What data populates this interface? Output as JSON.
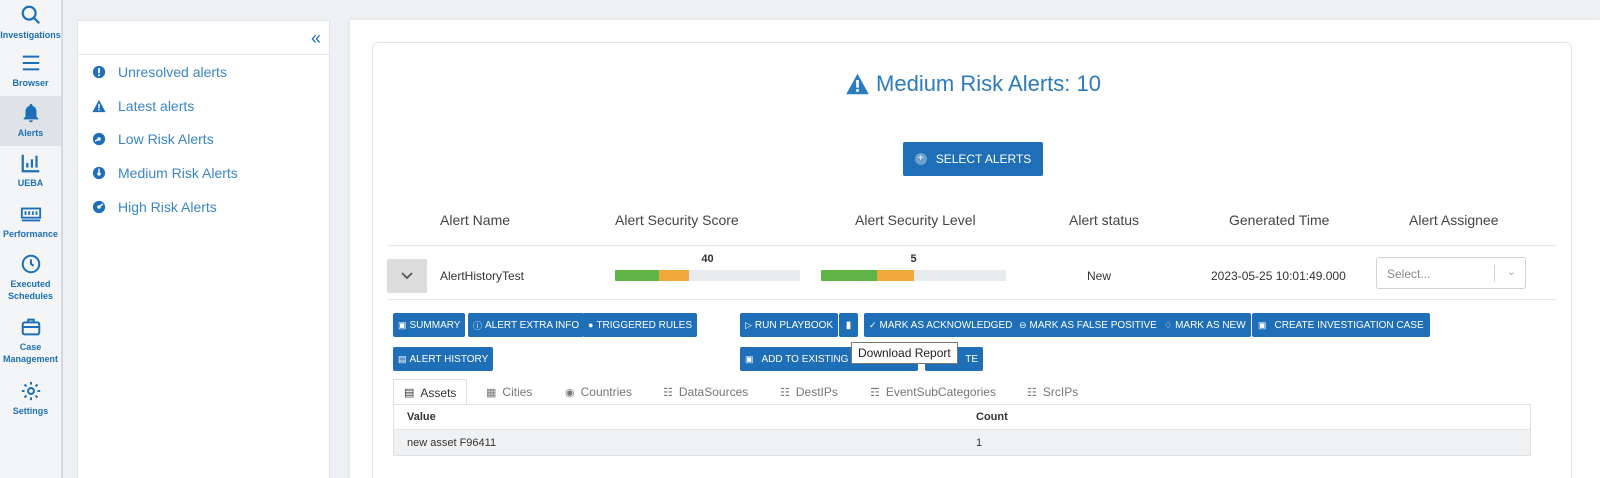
{
  "rail": {
    "items": [
      {
        "label": "Investigations",
        "icon": "search-icon"
      },
      {
        "label": "Browser",
        "icon": "menu-icon"
      },
      {
        "label": "Alerts",
        "icon": "bell-icon"
      },
      {
        "label": "UEBA",
        "icon": "chart-icon"
      },
      {
        "label": "Performance",
        "icon": "memory-icon"
      },
      {
        "label": "Executed Schedules",
        "icon": "clock-icon"
      },
      {
        "label": "Case Management",
        "icon": "briefcase-icon"
      },
      {
        "label": "Settings",
        "icon": "gear-icon"
      }
    ]
  },
  "sidebar": {
    "items": [
      {
        "label": "Unresolved alerts",
        "icon": "exclamation-circle-icon"
      },
      {
        "label": "Latest alerts",
        "icon": "warning-triangle-icon"
      },
      {
        "label": "Low Risk Alerts",
        "icon": "gauge-low-icon"
      },
      {
        "label": "Medium Risk Alerts",
        "icon": "gauge-medium-icon"
      },
      {
        "label": "High Risk Alerts",
        "icon": "gauge-high-icon"
      }
    ]
  },
  "main": {
    "title": "Medium Risk Alerts: 10",
    "select_button": "SELECT ALERTS",
    "columns": [
      "Alert Name",
      "Alert Security Score",
      "Alert Security Level",
      "Alert status",
      "Generated Time",
      "Alert Assignee"
    ],
    "alert": {
      "name": "AlertHistoryTest",
      "score": "40",
      "score_fill": 0.4,
      "level": "5",
      "level_fill": 0.5,
      "status": "New",
      "time": "2023-05-25 10:01:49.000",
      "assignee_placeholder": "Select..."
    },
    "actions": {
      "summary": "SUMMARY",
      "extra_info": "ALERT EXTRA INFO",
      "triggered_rules": "TRIGGERED RULES",
      "alert_history": "ALERT HISTORY",
      "run_playbook": "RUN PLAYBOOK",
      "ack": "MARK AS ACKNOWLEDGED",
      "false_positive": "MARK AS FALSE POSITIVE",
      "mark_new": "MARK AS NEW",
      "create_case": "CREATE INVESTIGATION CASE",
      "add_existing": "ADD TO EXISTING INV",
      "delete_partial": "TE"
    },
    "tooltip": "Download Report",
    "tabs": [
      "Assets",
      "Cities",
      "Countries",
      "DataSources",
      "DestIPs",
      "EventSubCategories",
      "SrcIPs"
    ],
    "table": {
      "headers": [
        "Value",
        "Count"
      ],
      "rows": [
        [
          "new asset F96411",
          "1"
        ]
      ]
    }
  }
}
